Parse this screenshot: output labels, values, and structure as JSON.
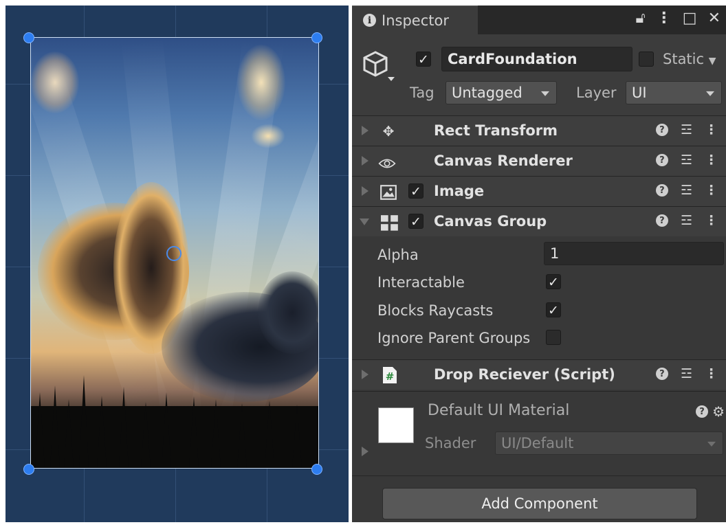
{
  "inspector": {
    "tab_label": "Inspector",
    "window_icons": [
      "lock-icon",
      "more-icon",
      "maximize-icon",
      "close-icon"
    ]
  },
  "gameobject": {
    "active": true,
    "name": "CardFoundation",
    "static_label": "Static",
    "tag_label": "Tag",
    "tag_value": "Untagged",
    "layer_label": "Layer",
    "layer_value": "UI"
  },
  "components": [
    {
      "title": "Rect Transform",
      "icon": "rect-transform-icon",
      "has_checkbox": false,
      "expanded": false
    },
    {
      "title": "Canvas Renderer",
      "icon": "eye-icon",
      "has_checkbox": false,
      "expanded": false
    },
    {
      "title": "Image",
      "icon": "image-icon",
      "has_checkbox": true,
      "expanded": false
    },
    {
      "title": "Canvas Group",
      "icon": "canvas-group-icon",
      "has_checkbox": true,
      "expanded": true
    },
    {
      "title": "Drop Reciever (Script)",
      "icon": "script-icon",
      "has_checkbox": false,
      "expanded": false
    }
  ],
  "canvas_group": {
    "alpha_label": "Alpha",
    "alpha_value": "1",
    "interactable_label": "Interactable",
    "interactable": true,
    "blocks_raycasts_label": "Blocks Raycasts",
    "blocks_raycasts": true,
    "ignore_parent_groups_label": "Ignore Parent Groups",
    "ignore_parent_groups": false
  },
  "material": {
    "name": "Default UI Material",
    "shader_label": "Shader",
    "shader_value": "UI/Default",
    "swatch_color": "#ffffff"
  },
  "add_component_label": "Add Component",
  "colors": {
    "scene_background": "#203a5c",
    "inspector_background": "#383838",
    "handle": "#2d7df0"
  }
}
